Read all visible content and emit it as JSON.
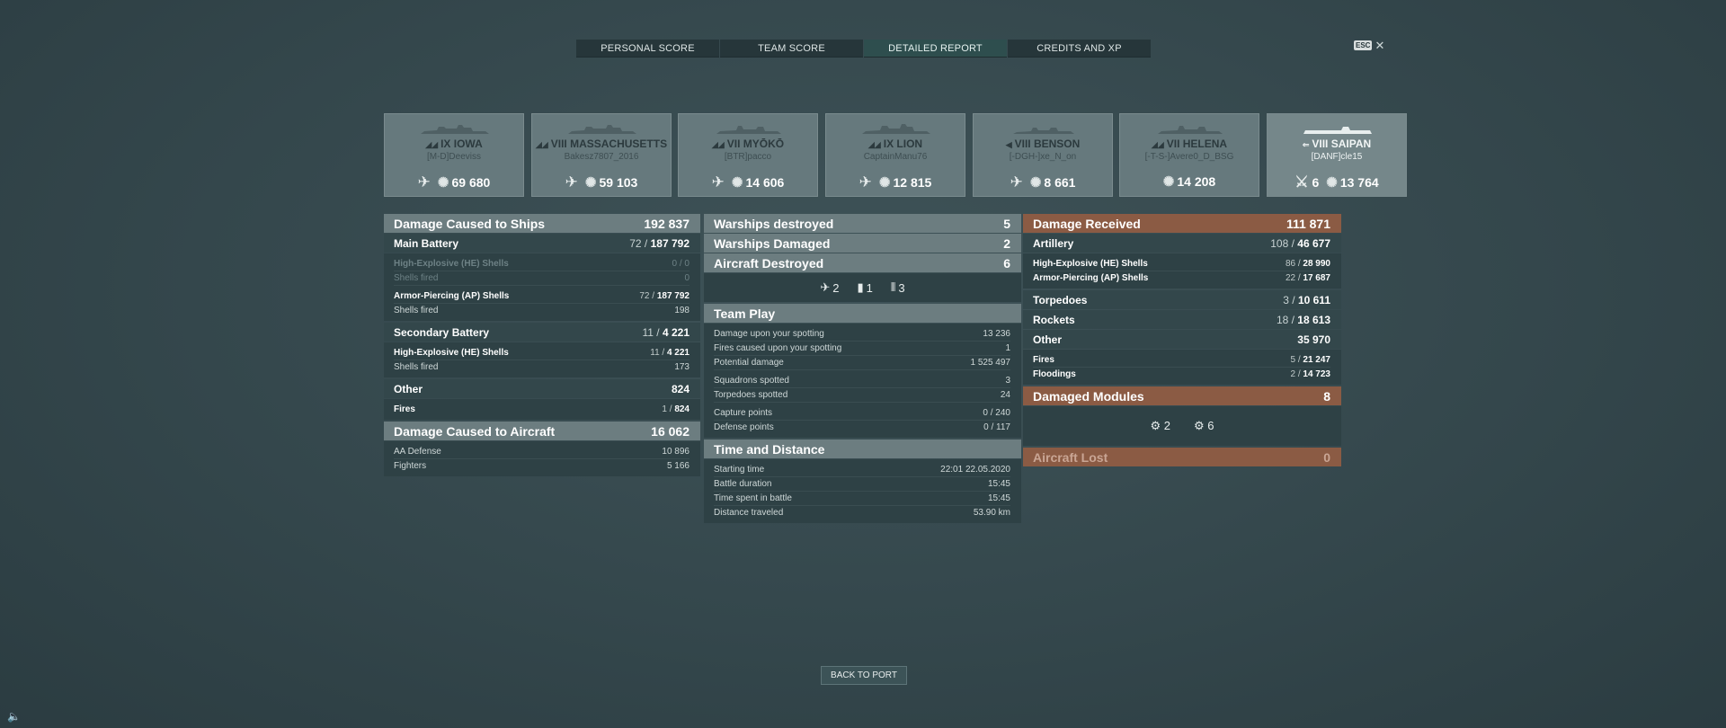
{
  "tabs": [
    {
      "label": "PERSONAL SCORE"
    },
    {
      "label": "TEAM SCORE"
    },
    {
      "label": "DETAILED REPORT"
    },
    {
      "label": "CREDITS AND XP"
    }
  ],
  "esc": {
    "key": "ESC",
    "close": "✕"
  },
  "ships": [
    {
      "tier": "IX",
      "name": "IOWA",
      "player": "[M-D]Deeviss",
      "damage": "69 680",
      "kills": ""
    },
    {
      "tier": "VIII",
      "name": "MASSACHUSETTS",
      "player": "Bakesz7807_2016",
      "damage": "59 103",
      "kills": ""
    },
    {
      "tier": "VII",
      "name": "MYŌKŌ",
      "player": "[BTR]pacco",
      "damage": "14 606",
      "kills": ""
    },
    {
      "tier": "IX",
      "name": "LION",
      "player": "CaptainManu76",
      "damage": "12 815",
      "kills": ""
    },
    {
      "tier": "VIII",
      "name": "BENSON",
      "player": "[-DGH-]xe_N_on",
      "damage": "8 661",
      "kills": ""
    },
    {
      "tier": "VII",
      "name": "HELENA",
      "player": "[-T-S-]Avere0_D_BSG",
      "damage": "14 208",
      "kills": ""
    },
    {
      "tier": "VIII",
      "name": "SAIPAN",
      "player": "[DANF]cle15",
      "damage": "13 764",
      "kills": "6"
    }
  ],
  "left": {
    "damage_ships": {
      "label": "Damage Caused to Ships",
      "value": "192 837"
    },
    "main_battery": {
      "label": "Main Battery",
      "hits": "72 /",
      "value": "187 792"
    },
    "he_shells": {
      "label": "High-Explosive (HE) Shells",
      "value": "0 / 0"
    },
    "shells_fired_1": {
      "label": "Shells fired",
      "value": "0"
    },
    "ap_shells": {
      "label": "Armor-Piercing (AP) Shells",
      "hits": "72 /",
      "value": "187 792"
    },
    "shells_fired_2": {
      "label": "Shells fired",
      "value": "198"
    },
    "secondary": {
      "label": "Secondary Battery",
      "hits": "11 /",
      "value": "4 221"
    },
    "sec_he": {
      "label": "High-Explosive (HE) Shells",
      "hits": "11 /",
      "value": "4 221"
    },
    "shells_fired_3": {
      "label": "Shells fired",
      "value": "173"
    },
    "other": {
      "label": "Other",
      "value": "824"
    },
    "fires": {
      "label": "Fires",
      "hits": "1 /",
      "value": "824"
    },
    "damage_aircraft": {
      "label": "Damage Caused to Aircraft",
      "value": "16 062"
    },
    "aa_defense": {
      "label": "AA Defense",
      "value": "10 896"
    },
    "fighters": {
      "label": "Fighters",
      "value": "5 166"
    }
  },
  "middle": {
    "warships_destroyed": {
      "label": "Warships destroyed",
      "value": "5"
    },
    "warships_damaged": {
      "label": "Warships Damaged",
      "value": "2"
    },
    "aircraft_destroyed": {
      "label": "Aircraft Destroyed",
      "value": "6"
    },
    "aircraft_icons": [
      {
        "value": "2"
      },
      {
        "value": "1"
      },
      {
        "value": "3"
      }
    ],
    "team_play": {
      "label": "Team Play"
    },
    "spot_damage": {
      "label": "Damage upon your spotting",
      "value": "13 236"
    },
    "spot_fires": {
      "label": "Fires caused upon your spotting",
      "value": "1"
    },
    "potential": {
      "label": "Potential damage",
      "value": "1 525 497"
    },
    "squadrons": {
      "label": "Squadrons spotted",
      "value": "3"
    },
    "torpedoes": {
      "label": "Torpedoes spotted",
      "value": "24"
    },
    "capture": {
      "label": "Capture points",
      "value": "0 / 240"
    },
    "defense": {
      "label": "Defense points",
      "value": "0 / 117"
    },
    "time_distance": {
      "label": "Time and Distance"
    },
    "start": {
      "label": "Starting time",
      "value": "22:01  22.05.2020"
    },
    "duration": {
      "label": "Battle duration",
      "value": "15:45"
    },
    "time_spent": {
      "label": "Time spent in battle",
      "value": "15:45"
    },
    "distance": {
      "label": "Distance traveled",
      "value": "53.90 km"
    }
  },
  "right": {
    "received": {
      "label": "Damage Received",
      "value": "111 871"
    },
    "artillery": {
      "label": "Artillery",
      "hits": "108 /",
      "value": "46 677"
    },
    "he": {
      "label": "High-Explosive (HE) Shells",
      "hits": "86 /",
      "value": "28 990"
    },
    "ap": {
      "label": "Armor-Piercing (AP) Shells",
      "hits": "22 /",
      "value": "17 687"
    },
    "torpedoes": {
      "label": "Torpedoes",
      "hits": "3 /",
      "value": "10 611"
    },
    "rockets": {
      "label": "Rockets",
      "hits": "18 /",
      "value": "18 613"
    },
    "other": {
      "label": "Other",
      "value": "35 970"
    },
    "fires": {
      "label": "Fires",
      "hits": "5 /",
      "value": "21 247"
    },
    "floodings": {
      "label": "Floodings",
      "hits": "2 /",
      "value": "14 723"
    },
    "modules": {
      "label": "Damaged Modules",
      "value": "8"
    },
    "module_icons": [
      {
        "value": "2"
      },
      {
        "value": "6"
      }
    ],
    "aircraft_lost": {
      "label": "Aircraft Lost",
      "value": "0"
    }
  },
  "back_button": "BACK TO PORT",
  "colors": {
    "accent_tab": "#2e4e4e",
    "received_header": "#8b5b44",
    "header_gray": "#6c7d80"
  }
}
